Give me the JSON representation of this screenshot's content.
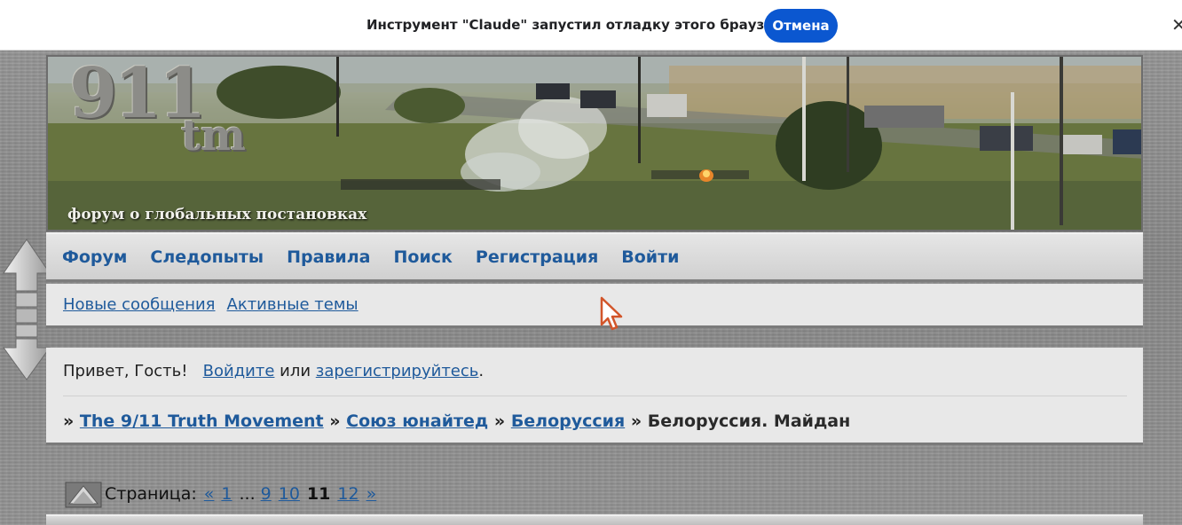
{
  "infobar": {
    "message": "Инструмент \"Claude\" запустил отладку этого браузера.",
    "cancel_label": "Отмена",
    "close_glyph": "✕"
  },
  "header": {
    "logo_number": "911",
    "logo_tm": "tm",
    "tagline": "форум о глобальных постановках"
  },
  "nav": {
    "items": [
      {
        "label": "Форум"
      },
      {
        "label": "Следопыты"
      },
      {
        "label": "Правила"
      },
      {
        "label": "Поиск"
      },
      {
        "label": "Регистрация"
      },
      {
        "label": "Войти"
      }
    ]
  },
  "subnav": {
    "items": [
      {
        "label": "Новые сообщения"
      },
      {
        "label": "Активные темы"
      }
    ]
  },
  "greeting": {
    "prefix": "Привет, Гость!",
    "login_link": "Войдите",
    "or": "или",
    "register_link": "зарегистрируйтесь",
    "suffix": "."
  },
  "breadcrumb": {
    "separator": "»",
    "items": [
      {
        "label": "The 9/11 Truth Movement"
      },
      {
        "label": "Союз юнайтед"
      },
      {
        "label": "Белоруссия"
      }
    ],
    "current": "Белоруссия. Майдан"
  },
  "pagination": {
    "label": "Страница:",
    "prev": "«",
    "first": "1",
    "ellipsis": "...",
    "pages_before": [
      "9",
      "10"
    ],
    "current": "11",
    "pages_after": [
      "12"
    ],
    "next": "»"
  },
  "colors": {
    "link": "#1f5a9b",
    "infobar_button": "#0b57d0"
  },
  "icons": {
    "scroll": "up-down-arrows-icon",
    "pager": "pages-icon",
    "cursor": "mouse-cursor-icon"
  }
}
